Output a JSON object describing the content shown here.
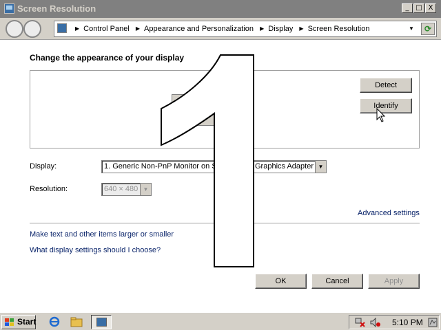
{
  "window": {
    "title": "Screen Resolution",
    "controls": {
      "minimize": "_",
      "maximize": "□",
      "close": "X"
    }
  },
  "address_bar": {
    "crumbs": [
      "Control Panel",
      "Appearance and Personalization",
      "Display",
      "Screen Resolution"
    ],
    "separator": "▶",
    "dropdown_glyph": "▼",
    "refresh_glyph": "⟳"
  },
  "main": {
    "heading": "Change the appearance of your display",
    "detect_label": "Detect",
    "identify_label": "Identify",
    "identify_number": "1",
    "display_label": "Display:",
    "display_value": "1. Generic Non-PnP Monitor on St",
    "display_value_tail": "Graphics Adapter",
    "resolution_label": "Resolution:",
    "resolution_value": "640 × 480",
    "advanced_link": "Advanced settings",
    "links": [
      "Make text and other items larger or smaller",
      "What display settings should I choose?"
    ],
    "ok_label": "OK",
    "cancel_label": "Cancel",
    "apply_label": "Apply"
  },
  "taskbar": {
    "start_label": "Start",
    "clock": "5:10 PM",
    "quick_launch": [
      "ie-icon",
      "explorer-icon"
    ],
    "tray_icons": [
      "network-disconnected-icon",
      "volume-muted-icon",
      "action-center-icon"
    ]
  },
  "colors": {
    "titlebar": "#808080",
    "chrome": "#d4d0c8",
    "link": "#0a246a",
    "disabled_text": "#909090"
  }
}
